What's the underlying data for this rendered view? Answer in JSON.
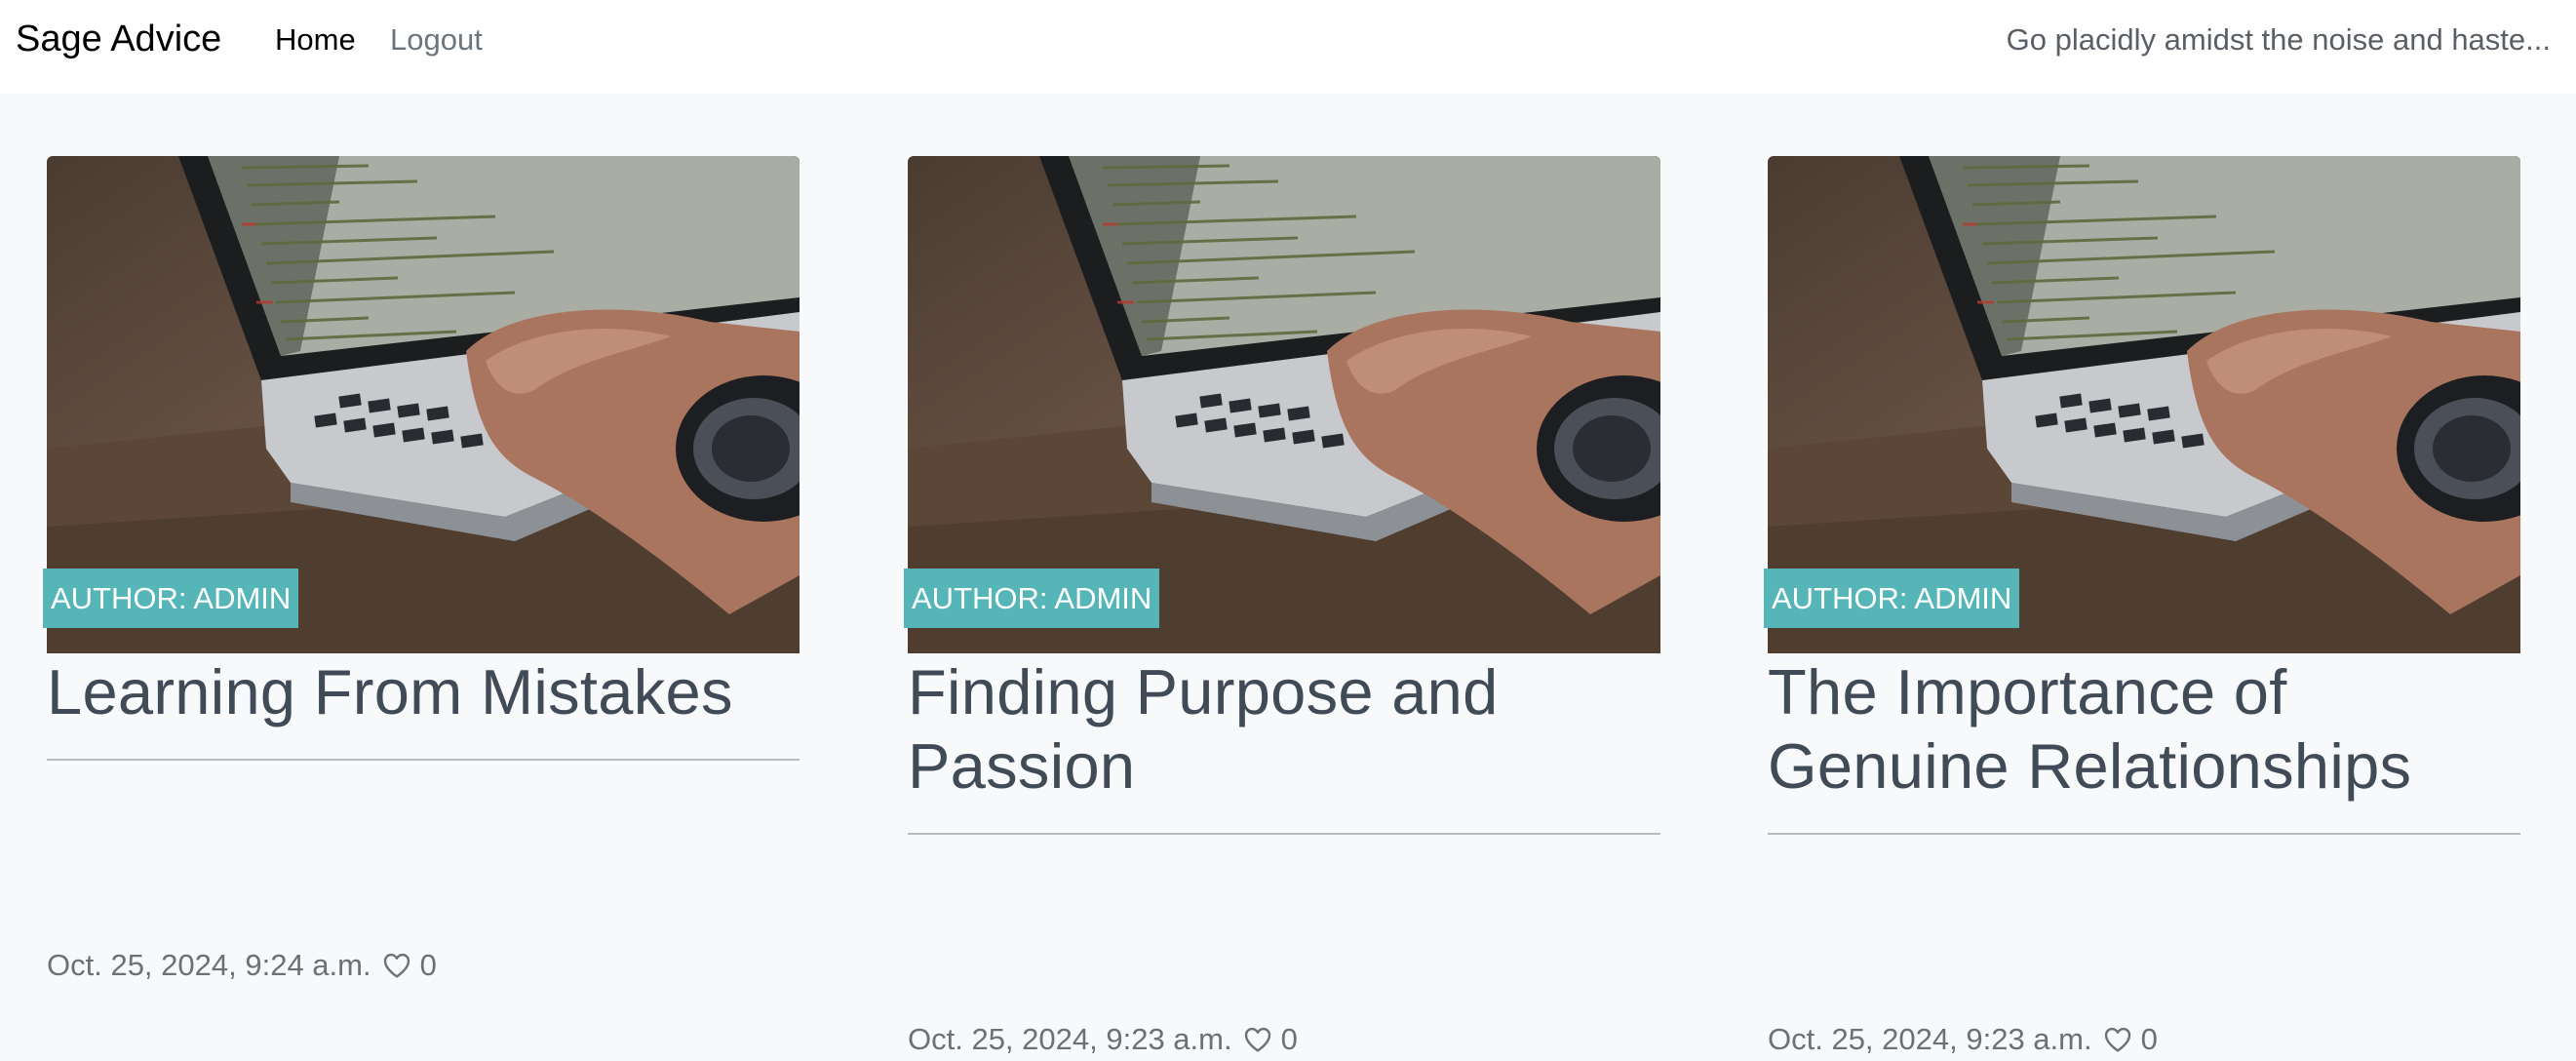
{
  "navbar": {
    "brand": "Sage Advice",
    "links": [
      {
        "label": "Home"
      },
      {
        "label": "Logout"
      }
    ],
    "tagline": "Go placidly amidst the noise and haste..."
  },
  "posts": [
    {
      "author_badge": "AUTHOR: ADMIN",
      "title": "Learning From Mistakes",
      "date": "Oct. 25, 2024, 9:24 a.m.",
      "likes": "0",
      "like_icon": "heart-outline-icon"
    },
    {
      "author_badge": "AUTHOR: ADMIN",
      "title": "Finding Purpose and Passion",
      "date": "Oct. 25, 2024, 9:23 a.m.",
      "likes": "0",
      "like_icon": "heart-outline-icon"
    },
    {
      "author_badge": "AUTHOR: ADMIN",
      "title": "The Importance of Genuine Relationships",
      "date": "Oct. 25, 2024, 9:23 a.m.",
      "likes": "0",
      "like_icon": "heart-outline-icon"
    }
  ],
  "colors": {
    "badge": "#55b5b7",
    "title": "#414a57",
    "page_background": "#f8f9fa"
  }
}
